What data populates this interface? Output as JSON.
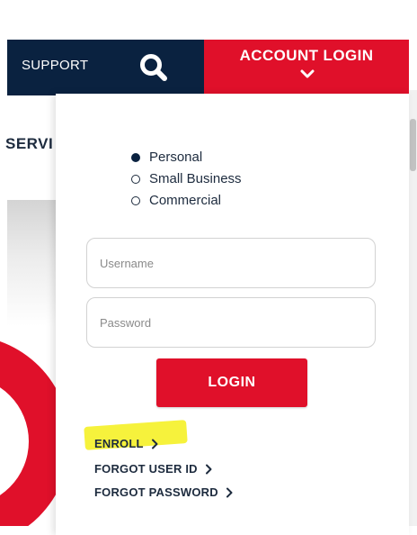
{
  "nav": {
    "support_label": "SUPPORT",
    "account_login_label": "ACCOUNT LOGIN",
    "search_icon": "search-icon",
    "chevron_icon": "chevron-down-icon"
  },
  "background": {
    "services_text": "SERVI"
  },
  "login_panel": {
    "account_types": [
      {
        "label": "Personal",
        "selected": true
      },
      {
        "label": "Small Business",
        "selected": false
      },
      {
        "label": "Commercial",
        "selected": false
      }
    ],
    "username_placeholder": "Username",
    "password_placeholder": "Password",
    "login_button_label": "LOGIN",
    "links": [
      {
        "label": "ENROLL",
        "icon": "chevron-right-icon"
      },
      {
        "label": "FORGOT USER ID",
        "icon": "chevron-right-icon"
      },
      {
        "label": "FORGOT PASSWORD",
        "icon": "chevron-right-icon"
      }
    ]
  },
  "colors": {
    "navy": "#0a2240",
    "brand_red": "#e0102a",
    "highlight_yellow": "#f6f23c"
  }
}
